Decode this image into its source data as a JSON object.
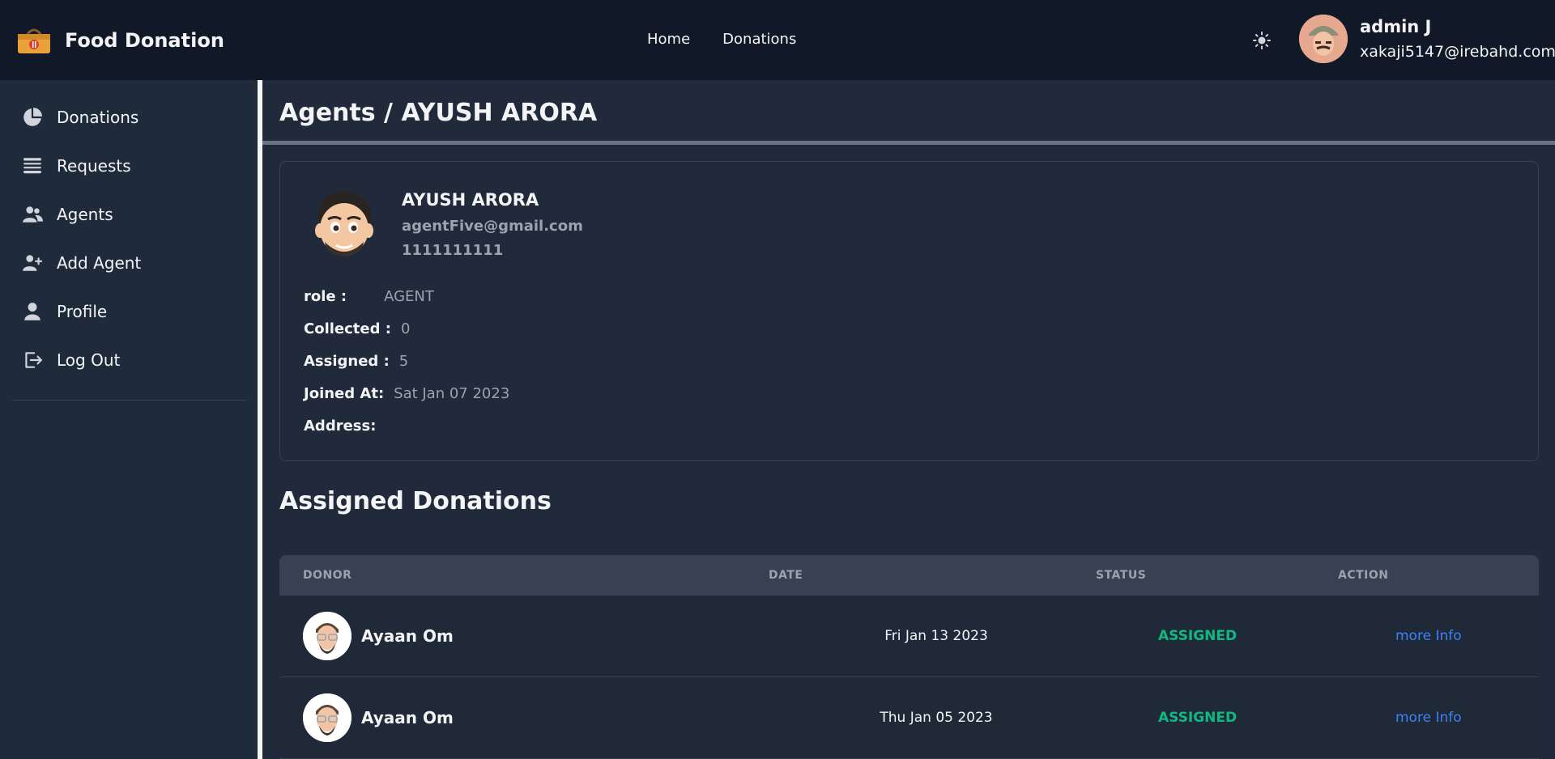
{
  "header": {
    "brand": "Food Donation",
    "nav": [
      "Home",
      "Donations"
    ],
    "user": {
      "name": "admin J",
      "email": "xakaji5147@irebahd.com"
    }
  },
  "sidebar": {
    "items": [
      {
        "label": "Donations",
        "icon": "pie-chart-icon"
      },
      {
        "label": "Requests",
        "icon": "list-icon"
      },
      {
        "label": "Agents",
        "icon": "users-icon"
      },
      {
        "label": "Add Agent",
        "icon": "user-plus-icon"
      },
      {
        "label": "Profile",
        "icon": "user-icon"
      },
      {
        "label": "Log Out",
        "icon": "logout-icon"
      }
    ]
  },
  "page": {
    "title": "Agents / AYUSH ARORA",
    "agent": {
      "name": "AYUSH ARORA",
      "email": "agentFive@gmail.com",
      "phone": "1111111111",
      "fields": [
        {
          "key": "role :",
          "value": "AGENT"
        },
        {
          "key": "Collected :",
          "value": "0"
        },
        {
          "key": "Assigned :",
          "value": "5"
        },
        {
          "key": "Joined At:",
          "value": "Sat Jan 07 2023"
        },
        {
          "key": "Address:",
          "value": ""
        }
      ]
    },
    "section_title": "Assigned Donations",
    "table": {
      "headers": [
        "DONOR",
        "DATE",
        "STATUS",
        "ACTION"
      ],
      "rows": [
        {
          "donor": "Ayaan Om",
          "date": "Fri Jan 13 2023",
          "status": "ASSIGNED",
          "action": "more Info"
        },
        {
          "donor": "Ayaan Om",
          "date": "Thu Jan 05 2023",
          "status": "ASSIGNED",
          "action": "more Info"
        }
      ]
    }
  },
  "colors": {
    "header_bg": "#111827",
    "sidebar_bg": "#1f2a3b",
    "main_bg": "#212a3a",
    "status_assigned": "#10b981",
    "link": "#3b82f6"
  }
}
